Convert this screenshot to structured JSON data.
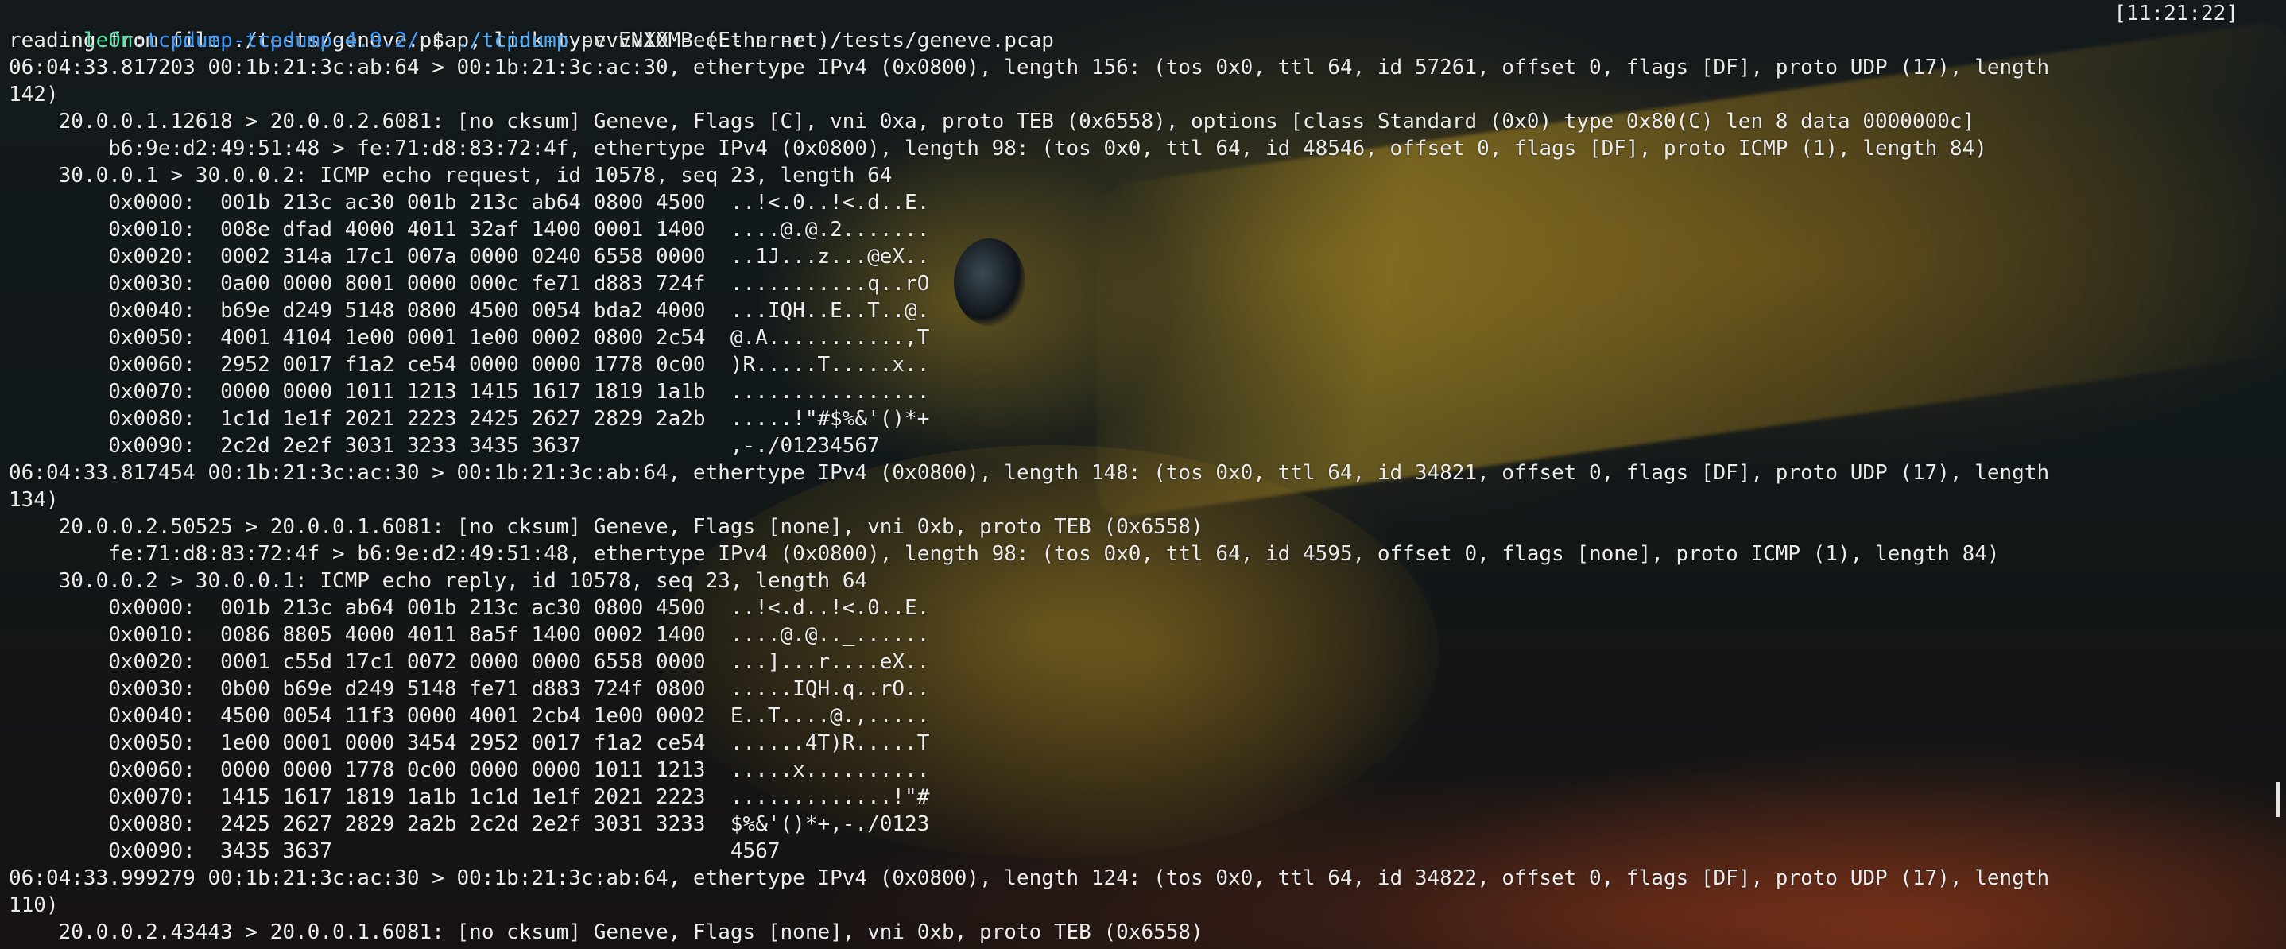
{
  "prompt": {
    "user": "le0n",
    "separator": ":",
    "path": "tcpdump-tcpdump-4.9.2/",
    "symbol": " $ ",
    "command": "./tcpdump",
    "args": " -vvvvXX -ee -nn -r ./tests/geneve.pcap",
    "time": "[11:21:22]"
  },
  "colors": {
    "user": "#58e6a8",
    "path": "#3b9cff",
    "command": "#4bb0ff",
    "text": "#ececec"
  },
  "output": [
    "reading from file ./tests/geneve.pcap, link-type EN10MB (Ethernet)",
    "06:04:33.817203 00:1b:21:3c:ab:64 > 00:1b:21:3c:ac:30, ethertype IPv4 (0x0800), length 156: (tos 0x0, ttl 64, id 57261, offset 0, flags [DF], proto UDP (17), length",
    "142)",
    "    20.0.0.1.12618 > 20.0.0.2.6081: [no cksum] Geneve, Flags [C], vni 0xa, proto TEB (0x6558), options [class Standard (0x0) type 0x80(C) len 8 data 0000000c]",
    "        b6:9e:d2:49:51:48 > fe:71:d8:83:72:4f, ethertype IPv4 (0x0800), length 98: (tos 0x0, ttl 64, id 48546, offset 0, flags [DF], proto ICMP (1), length 84)",
    "    30.0.0.1 > 30.0.0.2: ICMP echo request, id 10578, seq 23, length 64",
    "        0x0000:  001b 213c ac30 001b 213c ab64 0800 4500  ..!<.0..!<.d..E.",
    "        0x0010:  008e dfad 4000 4011 32af 1400 0001 1400  ....@.@.2.......",
    "        0x0020:  0002 314a 17c1 007a 0000 0240 6558 0000  ..1J...z...@eX..",
    "        0x0030:  0a00 0000 8001 0000 000c fe71 d883 724f  ...........q..rO",
    "        0x0040:  b69e d249 5148 0800 4500 0054 bda2 4000  ...IQH..E..T..@.",
    "        0x0050:  4001 4104 1e00 0001 1e00 0002 0800 2c54  @.A...........,T",
    "        0x0060:  2952 0017 f1a2 ce54 0000 0000 1778 0c00  )R.....T.....x..",
    "        0x0070:  0000 0000 1011 1213 1415 1617 1819 1a1b  ................",
    "        0x0080:  1c1d 1e1f 2021 2223 2425 2627 2829 2a2b  .....!\"#$%&'()*+",
    "        0x0090:  2c2d 2e2f 3031 3233 3435 3637            ,-./01234567",
    "06:04:33.817454 00:1b:21:3c:ac:30 > 00:1b:21:3c:ab:64, ethertype IPv4 (0x0800), length 148: (tos 0x0, ttl 64, id 34821, offset 0, flags [DF], proto UDP (17), length",
    "134)",
    "    20.0.0.2.50525 > 20.0.0.1.6081: [no cksum] Geneve, Flags [none], vni 0xb, proto TEB (0x6558)",
    "        fe:71:d8:83:72:4f > b6:9e:d2:49:51:48, ethertype IPv4 (0x0800), length 98: (tos 0x0, ttl 64, id 4595, offset 0, flags [none], proto ICMP (1), length 84)",
    "    30.0.0.2 > 30.0.0.1: ICMP echo reply, id 10578, seq 23, length 64",
    "        0x0000:  001b 213c ab64 001b 213c ac30 0800 4500  ..!<.d..!<.0..E.",
    "        0x0010:  0086 8805 4000 4011 8a5f 1400 0002 1400  ....@.@.._......",
    "        0x0020:  0001 c55d 17c1 0072 0000 0000 6558 0000  ...]...r....eX..",
    "        0x0030:  0b00 b69e d249 5148 fe71 d883 724f 0800  .....IQH.q..rO..",
    "        0x0040:  4500 0054 11f3 0000 4001 2cb4 1e00 0002  E..T....@.,.....",
    "        0x0050:  1e00 0001 0000 3454 2952 0017 f1a2 ce54  ......4T)R.....T",
    "        0x0060:  0000 0000 1778 0c00 0000 0000 1011 1213  .....x..........",
    "        0x0070:  1415 1617 1819 1a1b 1c1d 1e1f 2021 2223  .............!\"#",
    "        0x0080:  2425 2627 2829 2a2b 2c2d 2e2f 3031 3233  $%&'()*+,-./0123",
    "        0x0090:  3435 3637                                4567",
    "06:04:33.999279 00:1b:21:3c:ac:30 > 00:1b:21:3c:ab:64, ethertype IPv4 (0x0800), length 124: (tos 0x0, ttl 64, id 34822, offset 0, flags [DF], proto UDP (17), length",
    "110)",
    "    20.0.0.2.43443 > 20.0.0.1.6081: [no cksum] Geneve, Flags [none], vni 0xb, proto TEB (0x6558)"
  ]
}
